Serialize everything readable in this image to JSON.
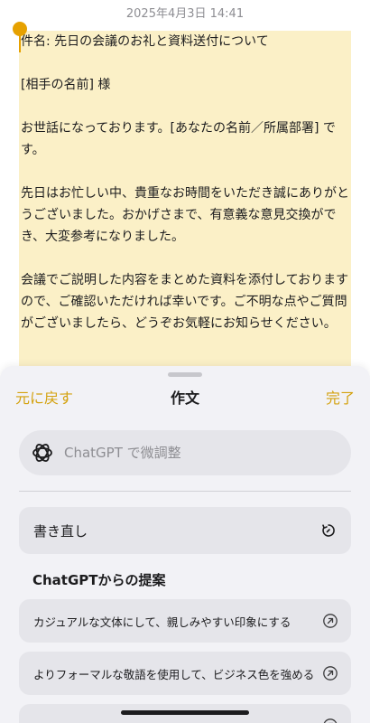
{
  "status": {
    "timestamp": "2025年4月3日 14:41"
  },
  "note": {
    "paragraphs": [
      "件名: 先日の会議のお礼と資料送付について",
      "[相手の名前] 様",
      "お世話になっております。[あなたの名前／所属部署] です。",
      "先日はお忙しい中、貴重なお時間をいただき誠にありがとうございました。おかげさまで、有意義な意見交換ができ、大変参考になりました。",
      "会議でご説明した内容をまとめた資料を添付しておりますので、ご確認いただければ幸いです。ご不明な点やご質問がございましたら、どうぞお気軽にお知らせください。"
    ],
    "highlight_color": "#fbf0c7",
    "handle_color": "#e6a100"
  },
  "sheet": {
    "undo_label": "元に戻す",
    "title": "作文",
    "done_label": "完了",
    "accent_color": "#d4a20f",
    "input_placeholder": "ChatGPT で微調整",
    "input_icon": "chatgpt-logo-icon",
    "rewrite_label": "書き直し",
    "rewrite_icon": "rewrite-refresh-icon",
    "suggestions_title": "ChatGPTからの提案",
    "suggestions": [
      {
        "label": "カジュアルな文体にして、親しみやすい印象にする",
        "icon": "arrow-up-right-icon"
      },
      {
        "label": "よりフォーマルな敬語を使用して、ビジネス色を強める",
        "icon": "arrow-up-right-icon"
      },
      {
        "label": "",
        "icon": "arrow-up-right-icon"
      }
    ]
  }
}
